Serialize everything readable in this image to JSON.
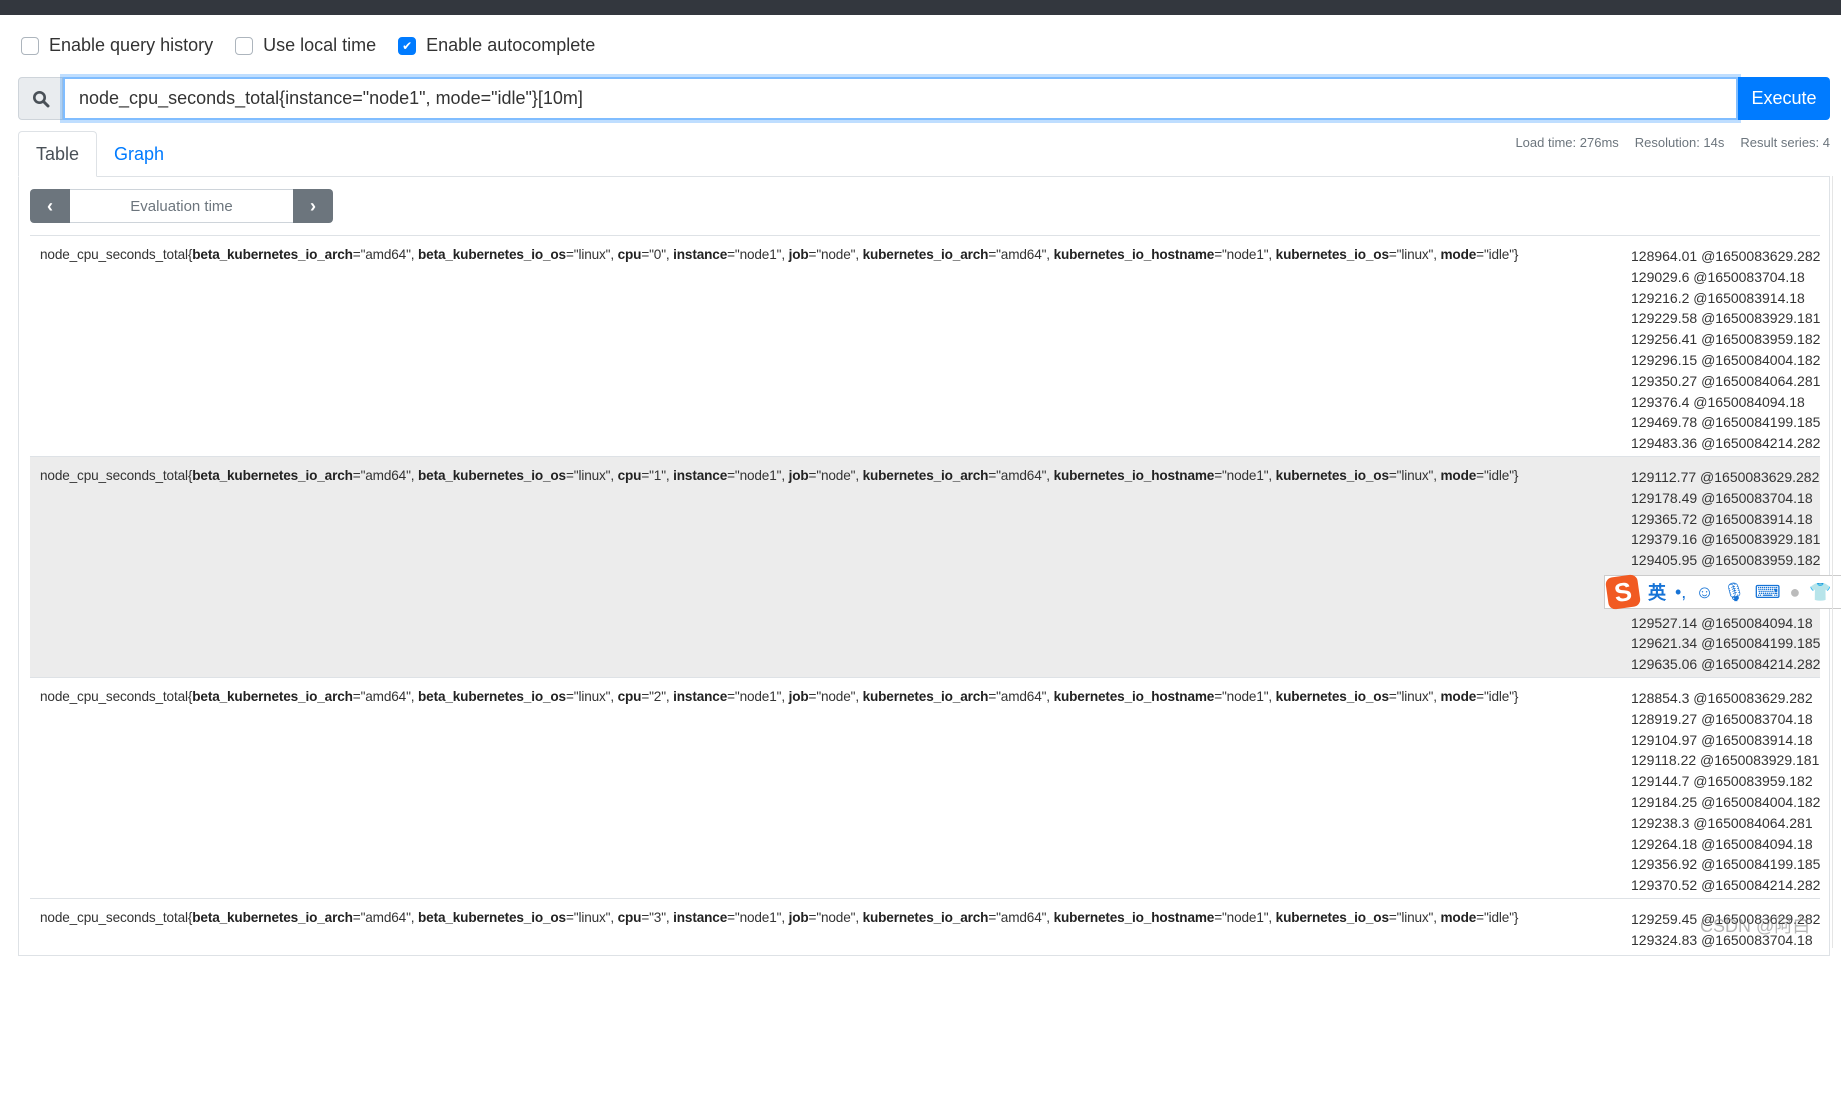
{
  "options": [
    {
      "label": "Enable query history",
      "checked": false
    },
    {
      "label": "Use local time",
      "checked": false
    },
    {
      "label": "Enable autocomplete",
      "checked": true
    }
  ],
  "search": {
    "icon": "search-icon",
    "query": "node_cpu_seconds_total{instance=\"node1\", mode=\"idle\"}[10m]",
    "execute_label": "Execute"
  },
  "tabs": [
    {
      "label": "Table",
      "active": true
    },
    {
      "label": "Graph",
      "active": false
    }
  ],
  "stats": {
    "load_time": "Load time: 276ms",
    "resolution": "Resolution: 14s",
    "result_series": "Result series: 4"
  },
  "eval": {
    "label": "Evaluation time",
    "prev": "‹",
    "next": "›"
  },
  "colors": {
    "accent": "#007bff",
    "navbar": "#33373e",
    "alt_row": "#ececec"
  },
  "results": [
    {
      "metric": "node_cpu_seconds_total",
      "labels": [
        [
          "beta_kubernetes_io_arch",
          "\"amd64\""
        ],
        [
          "beta_kubernetes_io_os",
          "\"linux\""
        ],
        [
          "cpu",
          "\"0\""
        ],
        [
          "instance",
          "\"node1\""
        ],
        [
          "job",
          "\"node\""
        ],
        [
          "kubernetes_io_arch",
          "\"amd64\""
        ],
        [
          "kubernetes_io_hostname",
          "\"node1\""
        ],
        [
          "kubernetes_io_os",
          "\"linux\""
        ],
        [
          "mode",
          "\"idle\""
        ]
      ],
      "values": [
        "128964.01 @1650083629.282",
        "129029.6 @1650083704.18",
        "129216.2 @1650083914.18",
        "129229.58 @1650083929.181",
        "129256.41 @1650083959.182",
        "129296.15 @1650084004.182",
        "129350.27 @1650084064.281",
        "129376.4 @1650084094.18",
        "129469.78 @1650084199.185",
        "129483.36 @1650084214.282"
      ]
    },
    {
      "metric": "node_cpu_seconds_total",
      "labels": [
        [
          "beta_kubernetes_io_arch",
          "\"amd64\""
        ],
        [
          "beta_kubernetes_io_os",
          "\"linux\""
        ],
        [
          "cpu",
          "\"1\""
        ],
        [
          "instance",
          "\"node1\""
        ],
        [
          "job",
          "\"node\""
        ],
        [
          "kubernetes_io_arch",
          "\"amd64\""
        ],
        [
          "kubernetes_io_hostname",
          "\"node1\""
        ],
        [
          "kubernetes_io_os",
          "\"linux\""
        ],
        [
          "mode",
          "\"idle\""
        ]
      ],
      "values": [
        "129112.77 @1650083629.282",
        "129178.49 @1650083704.18",
        "129365.72 @1650083914.18",
        "129379.16 @1650083929.181",
        "129405.95 @1650083959.182",
        "",
        "",
        "129527.14 @1650084094.18",
        "129621.34 @1650084199.185",
        "129635.06 @1650084214.282"
      ]
    },
    {
      "metric": "node_cpu_seconds_total",
      "labels": [
        [
          "beta_kubernetes_io_arch",
          "\"amd64\""
        ],
        [
          "beta_kubernetes_io_os",
          "\"linux\""
        ],
        [
          "cpu",
          "\"2\""
        ],
        [
          "instance",
          "\"node1\""
        ],
        [
          "job",
          "\"node\""
        ],
        [
          "kubernetes_io_arch",
          "\"amd64\""
        ],
        [
          "kubernetes_io_hostname",
          "\"node1\""
        ],
        [
          "kubernetes_io_os",
          "\"linux\""
        ],
        [
          "mode",
          "\"idle\""
        ]
      ],
      "values": [
        "128854.3 @1650083629.282",
        "128919.27 @1650083704.18",
        "129104.97 @1650083914.18",
        "129118.22 @1650083929.181",
        "129144.7 @1650083959.182",
        "129184.25 @1650084004.182",
        "129238.3 @1650084064.281",
        "129264.18 @1650084094.18",
        "129356.92 @1650084199.185",
        "129370.52 @1650084214.282"
      ]
    },
    {
      "metric": "node_cpu_seconds_total",
      "labels": [
        [
          "beta_kubernetes_io_arch",
          "\"amd64\""
        ],
        [
          "beta_kubernetes_io_os",
          "\"linux\""
        ],
        [
          "cpu",
          "\"3\""
        ],
        [
          "instance",
          "\"node1\""
        ],
        [
          "job",
          "\"node\""
        ],
        [
          "kubernetes_io_arch",
          "\"amd64\""
        ],
        [
          "kubernetes_io_hostname",
          "\"node1\""
        ],
        [
          "kubernetes_io_os",
          "\"linux\""
        ],
        [
          "mode",
          "\"idle\""
        ]
      ],
      "values": [
        "129259.45 @1650083629.282",
        "129324.83 @1650083704.18"
      ]
    }
  ],
  "ime_toolbar": {
    "logo": "S",
    "lang": "英",
    "punct": "•,"
  },
  "watermark": "CSDN @阿白"
}
